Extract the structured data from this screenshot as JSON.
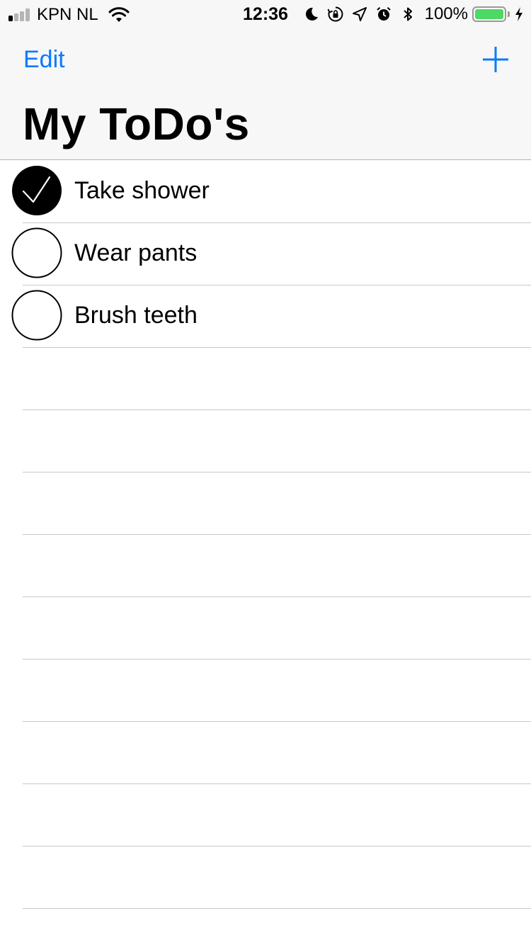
{
  "status_bar": {
    "carrier": "KPN NL",
    "time": "12:36",
    "battery_percent": "100%",
    "signal_bars_filled": 1,
    "signal_bars_total": 4,
    "icons": [
      "signal-icon",
      "wifi-icon",
      "moon-icon",
      "rotation-lock-icon",
      "location-icon",
      "alarm-icon",
      "bluetooth-icon",
      "battery-icon",
      "charging-icon"
    ],
    "battery_color": "#4cd964"
  },
  "nav": {
    "edit_label": "Edit",
    "add_icon": "plus-icon",
    "title": "My ToDo's",
    "tint_color": "#0a7aff"
  },
  "todos": [
    {
      "label": "Take shower",
      "done": true
    },
    {
      "label": "Wear pants",
      "done": false
    },
    {
      "label": "Brush teeth",
      "done": false
    }
  ],
  "empty_rows": 9
}
